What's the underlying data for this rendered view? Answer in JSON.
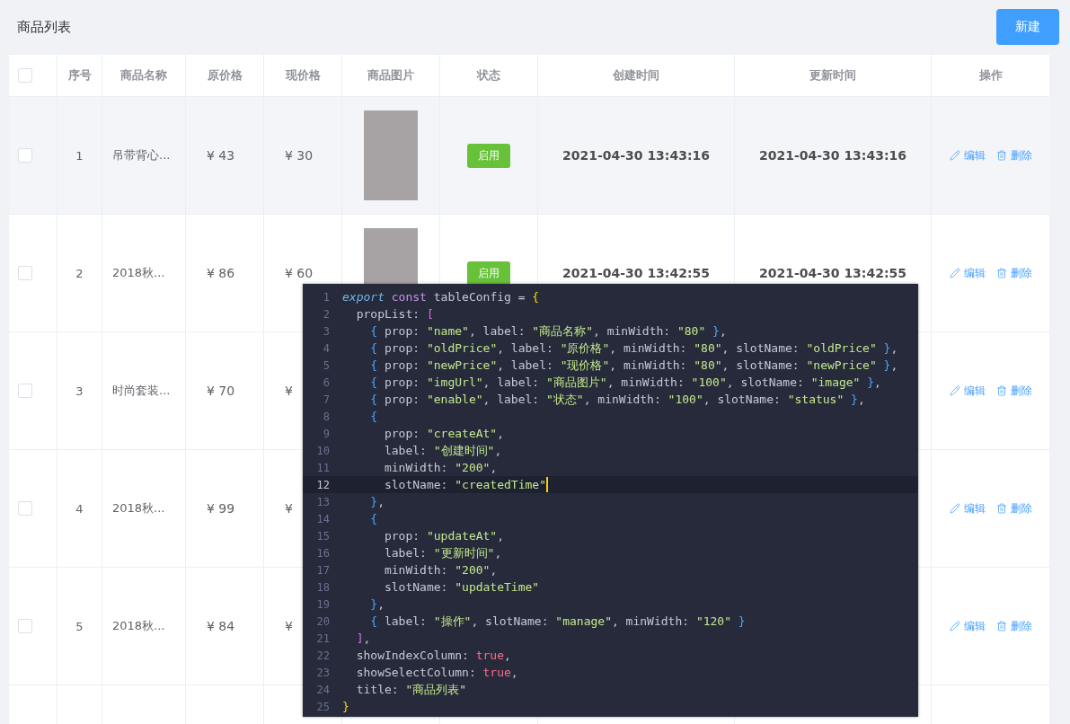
{
  "header": {
    "title": "商品列表",
    "new_button": "新建"
  },
  "table": {
    "select_all": {
      "checked": false
    },
    "columns": [
      "序号",
      "商品名称",
      "原价格",
      "现价格",
      "商品图片",
      "状态",
      "创建时间",
      "更新时间",
      "操作"
    ],
    "rows": [
      {
        "checked": false,
        "highlighted": true,
        "index": "1",
        "name": "吊带背心...",
        "old_price": "¥ 43",
        "new_price": "¥ 30",
        "photo": true,
        "status": "启用",
        "created": "2021-04-30 13:43:16",
        "updated": "2021-04-30 13:43:16",
        "actions": [
          "编辑",
          "删除"
        ]
      },
      {
        "checked": false,
        "highlighted": false,
        "index": "2",
        "name": "2018秋...",
        "old_price": "¥ 86",
        "new_price": "¥ 60",
        "photo": true,
        "status": "启用",
        "created": "2021-04-30 13:42:55",
        "updated": "2021-04-30 13:42:55",
        "actions": [
          "编辑",
          "删除"
        ]
      },
      {
        "checked": false,
        "highlighted": false,
        "index": "3",
        "name": "时尚套装...",
        "old_price": "¥ 70",
        "new_price": "¥",
        "actions": [
          "编辑",
          "删除"
        ]
      },
      {
        "checked": false,
        "highlighted": false,
        "index": "4",
        "name": "2018秋...",
        "old_price": "¥ 99",
        "new_price": "¥",
        "actions": [
          "编辑",
          "删除"
        ]
      },
      {
        "checked": false,
        "highlighted": false,
        "index": "5",
        "name": "2018秋...",
        "old_price": "¥ 84",
        "new_price": "¥",
        "actions": [
          "编辑",
          "删除"
        ]
      }
    ]
  },
  "code": {
    "lines": [
      {
        "n": "1",
        "active": false,
        "tokens": [
          {
            "kind": "kw",
            "text": "export"
          },
          {
            "kind": "storage",
            "text": " const"
          },
          {
            "kind": "plain",
            "text": " tableConfig = "
          },
          {
            "kind": "brace1",
            "text": "{"
          }
        ]
      },
      {
        "n": "2",
        "active": false,
        "tokens": [
          {
            "kind": "plain",
            "text": "  propList: "
          },
          {
            "kind": "brace2",
            "text": "["
          }
        ]
      },
      {
        "n": "3",
        "active": false,
        "tokens": [
          {
            "kind": "brace3",
            "text": "    {"
          },
          {
            "kind": "plain",
            "text": " prop: "
          },
          {
            "kind": "str",
            "text": "\"name\""
          },
          {
            "kind": "plain",
            "text": ", label: "
          },
          {
            "kind": "str",
            "text": "\"商品名称\""
          },
          {
            "kind": "plain",
            "text": ", minWidth: "
          },
          {
            "kind": "str",
            "text": "\"80\""
          },
          {
            "kind": "brace3",
            "text": " }"
          },
          {
            "kind": "plain",
            "text": ","
          }
        ]
      },
      {
        "n": "4",
        "active": false,
        "tokens": [
          {
            "kind": "brace3",
            "text": "    {"
          },
          {
            "kind": "plain",
            "text": " prop: "
          },
          {
            "kind": "str",
            "text": "\"oldPrice\""
          },
          {
            "kind": "plain",
            "text": ", label: "
          },
          {
            "kind": "str",
            "text": "\"原价格\""
          },
          {
            "kind": "plain",
            "text": ", minWidth: "
          },
          {
            "kind": "str",
            "text": "\"80\""
          },
          {
            "kind": "plain",
            "text": ", slotName: "
          },
          {
            "kind": "str",
            "text": "\"oldPrice\""
          },
          {
            "kind": "brace3",
            "text": " }"
          },
          {
            "kind": "plain",
            "text": ","
          }
        ]
      },
      {
        "n": "5",
        "active": false,
        "tokens": [
          {
            "kind": "brace3",
            "text": "    {"
          },
          {
            "kind": "plain",
            "text": " prop: "
          },
          {
            "kind": "str",
            "text": "\"newPrice\""
          },
          {
            "kind": "plain",
            "text": ", label: "
          },
          {
            "kind": "str",
            "text": "\"现价格\""
          },
          {
            "kind": "plain",
            "text": ", minWidth: "
          },
          {
            "kind": "str",
            "text": "\"80\""
          },
          {
            "kind": "plain",
            "text": ", slotName: "
          },
          {
            "kind": "str",
            "text": "\"newPrice\""
          },
          {
            "kind": "brace3",
            "text": " }"
          },
          {
            "kind": "plain",
            "text": ","
          }
        ]
      },
      {
        "n": "6",
        "active": false,
        "tokens": [
          {
            "kind": "brace3",
            "text": "    {"
          },
          {
            "kind": "plain",
            "text": " prop: "
          },
          {
            "kind": "str",
            "text": "\"imgUrl\""
          },
          {
            "kind": "plain",
            "text": ", label: "
          },
          {
            "kind": "str",
            "text": "\"商品图片\""
          },
          {
            "kind": "plain",
            "text": ", minWidth: "
          },
          {
            "kind": "str",
            "text": "\"100\""
          },
          {
            "kind": "plain",
            "text": ", slotName: "
          },
          {
            "kind": "str",
            "text": "\"image\""
          },
          {
            "kind": "brace3",
            "text": " }"
          },
          {
            "kind": "plain",
            "text": ","
          }
        ]
      },
      {
        "n": "7",
        "active": false,
        "tokens": [
          {
            "kind": "brace3",
            "text": "    {"
          },
          {
            "kind": "plain",
            "text": " prop: "
          },
          {
            "kind": "str",
            "text": "\"enable\""
          },
          {
            "kind": "plain",
            "text": ", label: "
          },
          {
            "kind": "str",
            "text": "\"状态\""
          },
          {
            "kind": "plain",
            "text": ", minWidth: "
          },
          {
            "kind": "str",
            "text": "\"100\""
          },
          {
            "kind": "plain",
            "text": ", slotName: "
          },
          {
            "kind": "str",
            "text": "\"status\""
          },
          {
            "kind": "brace3",
            "text": " }"
          },
          {
            "kind": "plain",
            "text": ","
          }
        ]
      },
      {
        "n": "8",
        "active": false,
        "tokens": [
          {
            "kind": "brace3",
            "text": "    {"
          }
        ]
      },
      {
        "n": "9",
        "active": false,
        "tokens": [
          {
            "kind": "plain",
            "text": "      prop: "
          },
          {
            "kind": "str",
            "text": "\"createAt\""
          },
          {
            "kind": "plain",
            "text": ","
          }
        ]
      },
      {
        "n": "10",
        "active": false,
        "tokens": [
          {
            "kind": "plain",
            "text": "      label: "
          },
          {
            "kind": "str",
            "text": "\"创建时间\""
          },
          {
            "kind": "plain",
            "text": ","
          }
        ]
      },
      {
        "n": "11",
        "active": false,
        "tokens": [
          {
            "kind": "plain",
            "text": "      minWidth: "
          },
          {
            "kind": "str",
            "text": "\"200\""
          },
          {
            "kind": "plain",
            "text": ","
          }
        ]
      },
      {
        "n": "12",
        "active": true,
        "tokens": [
          {
            "kind": "plain",
            "text": "      slotName: "
          },
          {
            "kind": "str",
            "text": "\"createdTime\""
          }
        ]
      },
      {
        "n": "13",
        "active": false,
        "tokens": [
          {
            "kind": "brace3",
            "text": "    }"
          },
          {
            "kind": "plain",
            "text": ","
          }
        ]
      },
      {
        "n": "14",
        "active": false,
        "tokens": [
          {
            "kind": "brace3",
            "text": "    {"
          }
        ]
      },
      {
        "n": "15",
        "active": false,
        "tokens": [
          {
            "kind": "plain",
            "text": "      prop: "
          },
          {
            "kind": "str",
            "text": "\"updateAt\""
          },
          {
            "kind": "plain",
            "text": ","
          }
        ]
      },
      {
        "n": "16",
        "active": false,
        "tokens": [
          {
            "kind": "plain",
            "text": "      label: "
          },
          {
            "kind": "str",
            "text": "\"更新时间\""
          },
          {
            "kind": "plain",
            "text": ","
          }
        ]
      },
      {
        "n": "17",
        "active": false,
        "tokens": [
          {
            "kind": "plain",
            "text": "      minWidth: "
          },
          {
            "kind": "str",
            "text": "\"200\""
          },
          {
            "kind": "plain",
            "text": ","
          }
        ]
      },
      {
        "n": "18",
        "active": false,
        "tokens": [
          {
            "kind": "plain",
            "text": "      slotName: "
          },
          {
            "kind": "str",
            "text": "\"updateTime\""
          }
        ]
      },
      {
        "n": "19",
        "active": false,
        "tokens": [
          {
            "kind": "brace3",
            "text": "    }"
          },
          {
            "kind": "plain",
            "text": ","
          }
        ]
      },
      {
        "n": "20",
        "active": false,
        "tokens": [
          {
            "kind": "brace3",
            "text": "    {"
          },
          {
            "kind": "plain",
            "text": " label: "
          },
          {
            "kind": "str",
            "text": "\"操作\""
          },
          {
            "kind": "plain",
            "text": ", slotName: "
          },
          {
            "kind": "str",
            "text": "\"manage\""
          },
          {
            "kind": "plain",
            "text": ", minWidth: "
          },
          {
            "kind": "str",
            "text": "\"120\""
          },
          {
            "kind": "brace3",
            "text": " }"
          }
        ]
      },
      {
        "n": "21",
        "active": false,
        "tokens": [
          {
            "kind": "brace2",
            "text": "  ]"
          },
          {
            "kind": "plain",
            "text": ","
          }
        ]
      },
      {
        "n": "22",
        "active": false,
        "tokens": [
          {
            "kind": "plain",
            "text": "  showIndexColumn: "
          },
          {
            "kind": "bool",
            "text": "true"
          },
          {
            "kind": "plain",
            "text": ","
          }
        ]
      },
      {
        "n": "23",
        "active": false,
        "tokens": [
          {
            "kind": "plain",
            "text": "  showSelectColumn: "
          },
          {
            "kind": "bool",
            "text": "true"
          },
          {
            "kind": "plain",
            "text": ","
          }
        ]
      },
      {
        "n": "24",
        "active": false,
        "tokens": [
          {
            "kind": "plain",
            "text": "  title: "
          },
          {
            "kind": "str",
            "text": "\"商品列表\""
          }
        ]
      },
      {
        "n": "25",
        "active": false,
        "tokens": [
          {
            "kind": "brace1",
            "text": "}"
          }
        ]
      }
    ]
  }
}
